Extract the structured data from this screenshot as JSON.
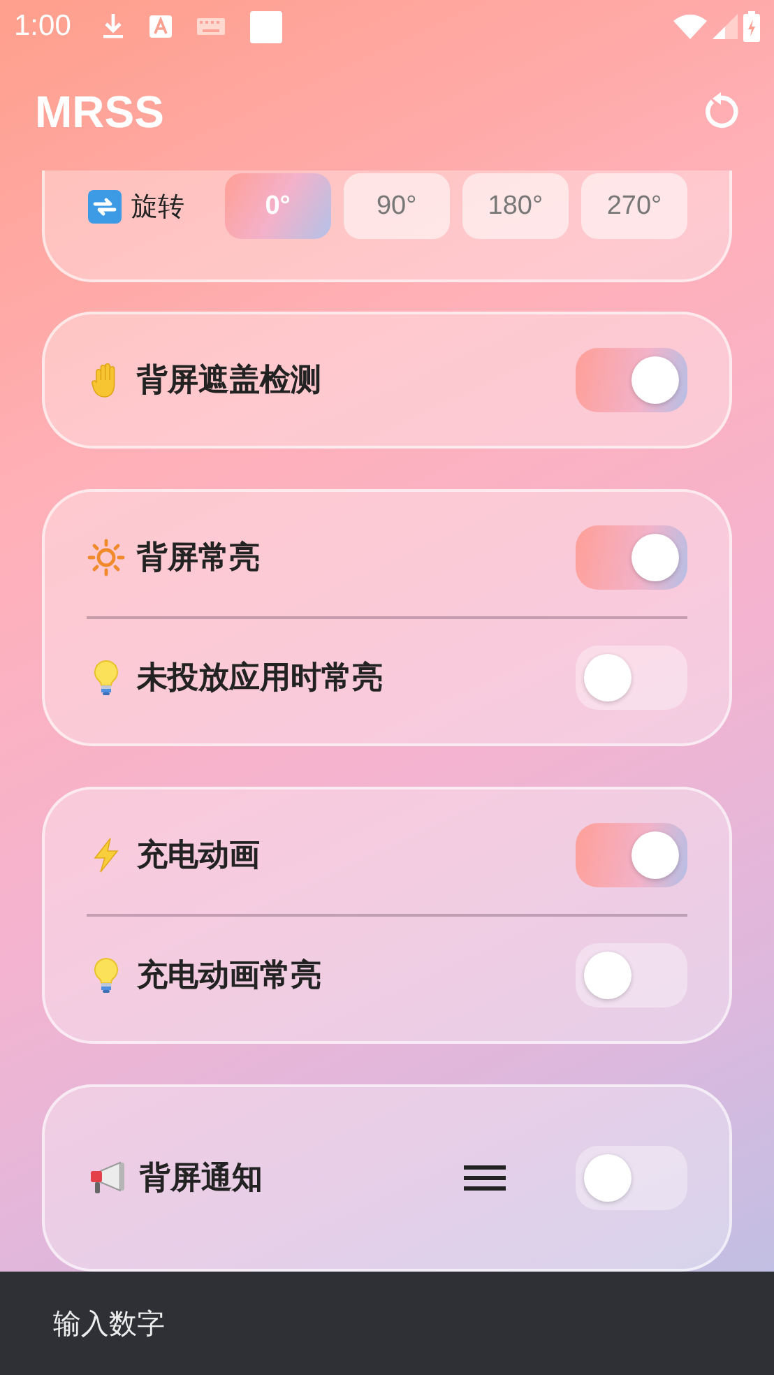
{
  "status_bar": {
    "time": "1:00"
  },
  "app_bar": {
    "title": "MRSS"
  },
  "rotation": {
    "label": "旋转",
    "options": [
      {
        "label": "0°",
        "selected": true
      },
      {
        "label": "90°",
        "selected": false
      },
      {
        "label": "180°",
        "selected": false
      },
      {
        "label": "270°",
        "selected": false
      }
    ]
  },
  "cards": [
    {
      "rows": [
        {
          "label": "背屏遮盖检测",
          "on": true
        }
      ]
    },
    {
      "rows": [
        {
          "label": "背屏常亮",
          "on": true
        },
        {
          "label": "未投放应用时常亮",
          "on": false
        }
      ]
    },
    {
      "rows": [
        {
          "label": "充电动画",
          "on": true
        },
        {
          "label": "充电动画常亮",
          "on": false
        }
      ]
    },
    {
      "rows": [
        {
          "label": "背屏通知",
          "on": false,
          "menu": true
        }
      ]
    }
  ],
  "toast": {
    "text": "输入数字"
  }
}
